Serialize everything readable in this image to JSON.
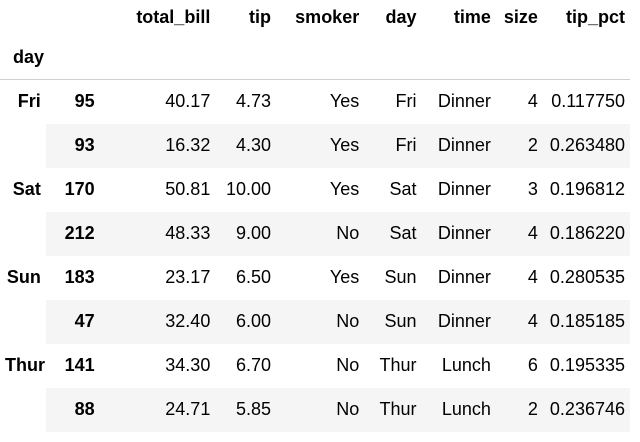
{
  "table": {
    "columns": [
      "total_bill",
      "tip",
      "smoker",
      "day",
      "time",
      "size",
      "tip_pct"
    ],
    "index_name": "day",
    "rows": [
      {
        "group": "Fri",
        "idx": "95",
        "cells": [
          "40.17",
          "4.73",
          "Yes",
          "Fri",
          "Dinner",
          "4",
          "0.117750"
        ]
      },
      {
        "group": "",
        "idx": "93",
        "cells": [
          "16.32",
          "4.30",
          "Yes",
          "Fri",
          "Dinner",
          "2",
          "0.263480"
        ]
      },
      {
        "group": "Sat",
        "idx": "170",
        "cells": [
          "50.81",
          "10.00",
          "Yes",
          "Sat",
          "Dinner",
          "3",
          "0.196812"
        ]
      },
      {
        "group": "",
        "idx": "212",
        "cells": [
          "48.33",
          "9.00",
          "No",
          "Sat",
          "Dinner",
          "4",
          "0.186220"
        ]
      },
      {
        "group": "Sun",
        "idx": "183",
        "cells": [
          "23.17",
          "6.50",
          "Yes",
          "Sun",
          "Dinner",
          "4",
          "0.280535"
        ]
      },
      {
        "group": "",
        "idx": "47",
        "cells": [
          "32.40",
          "6.00",
          "No",
          "Sun",
          "Dinner",
          "4",
          "0.185185"
        ]
      },
      {
        "group": "Thur",
        "idx": "141",
        "cells": [
          "34.30",
          "6.70",
          "No",
          "Thur",
          "Lunch",
          "6",
          "0.195335"
        ]
      },
      {
        "group": "",
        "idx": "88",
        "cells": [
          "24.71",
          "5.85",
          "No",
          "Thur",
          "Lunch",
          "2",
          "0.236746"
        ]
      }
    ]
  }
}
